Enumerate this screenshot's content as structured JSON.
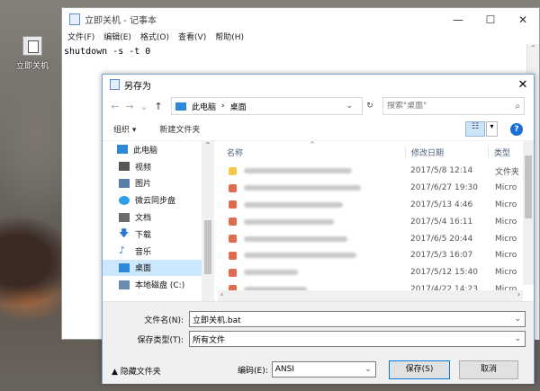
{
  "desktop": {
    "icon_label": "立即关机"
  },
  "notepad": {
    "title": "立即关机 - 记事本",
    "controls": [
      "—",
      "☐",
      "✕"
    ],
    "menu": [
      "文件(F)",
      "编辑(E)",
      "格式(O)",
      "查看(V)",
      "帮助(H)"
    ],
    "content": "shutdown -s -t 0"
  },
  "dialog": {
    "title": "另存为",
    "close": "✕",
    "address": {
      "path": [
        "此电脑",
        "›",
        "桌面"
      ]
    },
    "search": {
      "placeholder": "搜索\"桌面\""
    },
    "toolbar": {
      "organize": "组织 ▾",
      "new_folder": "新建文件夹"
    },
    "nav": [
      {
        "label": "此电脑",
        "color": "#2d88d8"
      },
      {
        "label": "视频",
        "color": "#555555"
      },
      {
        "label": "图片",
        "color": "#5a7fa8"
      },
      {
        "label": "微云同步盘",
        "color": "#2f9ee8"
      },
      {
        "label": "文档",
        "color": "#6b6b6b"
      },
      {
        "label": "下载",
        "color": "#2b78d0"
      },
      {
        "label": "音乐",
        "color": "#2b78d0"
      },
      {
        "label": "桌面",
        "color": "#2d88d8"
      },
      {
        "label": "本地磁盘 (C:)",
        "color": "#6b8cb0"
      }
    ],
    "columns": {
      "name": "名称",
      "date": "修改日期",
      "type": "类型"
    },
    "files": [
      {
        "date": "2017/5/8 12:14",
        "type": "文件夹",
        "color": "#f5c84a",
        "blur_width": 120
      },
      {
        "date": "2017/6/27 19:30",
        "type": "Micro",
        "color": "#e26a4f",
        "blur_width": 130
      },
      {
        "date": "2017/5/13 4:46",
        "type": "Micro",
        "color": "#e26a4f",
        "blur_width": 110
      },
      {
        "date": "2017/5/4 16:11",
        "type": "Micro",
        "color": "#e26a4f",
        "blur_width": 100
      },
      {
        "date": "2017/6/5 20:44",
        "type": "Micro",
        "color": "#e26a4f",
        "blur_width": 115
      },
      {
        "date": "2017/5/3 16:07",
        "type": "Micro",
        "color": "#e26a4f",
        "blur_width": 125
      },
      {
        "date": "2017/5/12 15:40",
        "type": "Micro",
        "color": "#e26a4f",
        "blur_width": 60
      },
      {
        "date": "2017/4/22 14:23",
        "type": "Micro",
        "color": "#e26a4f",
        "blur_width": 70
      }
    ],
    "filename": {
      "label": "文件名(N):",
      "value": "立即关机.bat"
    },
    "filetype": {
      "label": "保存类型(T):",
      "value": "所有文件"
    },
    "hide_folders": "▲  隐藏文件夹",
    "encoding": {
      "label": "编码(E):",
      "value": "ANSI"
    },
    "save": "保存(S)",
    "cancel": "取消"
  }
}
